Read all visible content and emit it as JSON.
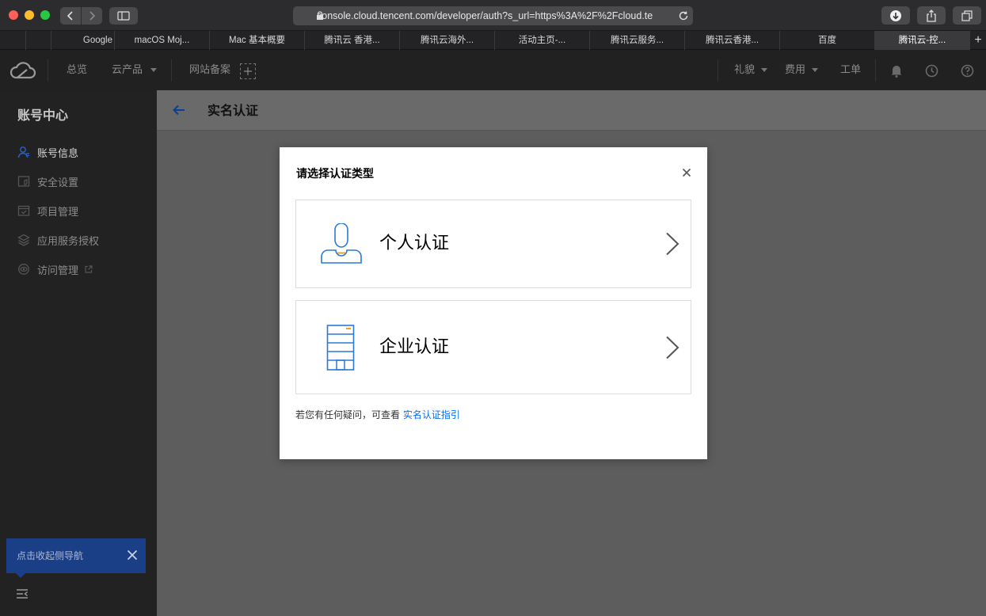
{
  "browser": {
    "url": "console.cloud.tencent.com/developer/auth?s_url=https%3A%2F%2Fcloud.te",
    "tabs": [
      {
        "label": "Google"
      },
      {
        "label": "macOS Moj..."
      },
      {
        "label": "Mac 基本概要"
      },
      {
        "label": "腾讯云 香港..."
      },
      {
        "label": "腾讯云海外..."
      },
      {
        "label": "活动主页-..."
      },
      {
        "label": "腾讯云服务..."
      },
      {
        "label": "腾讯云香港..."
      },
      {
        "label": "百度"
      },
      {
        "label": "腾讯云-控..."
      }
    ],
    "new_tab": "+"
  },
  "topnav": {
    "overview": "总览",
    "products": "云产品",
    "beian": "网站备案",
    "gifts": "礼貌",
    "billing": "费用",
    "tickets": "工单"
  },
  "sidebar": {
    "title": "账号中心",
    "items": [
      {
        "label": "账号信息",
        "icon": "user-icon",
        "active": true
      },
      {
        "label": "安全设置",
        "icon": "shield-icon",
        "active": false
      },
      {
        "label": "项目管理",
        "icon": "project-icon",
        "active": false
      },
      {
        "label": "应用服务授权",
        "icon": "layers-icon",
        "active": false
      },
      {
        "label": "访问管理",
        "icon": "access-icon",
        "active": false
      }
    ],
    "toast": "点击收起侧导航"
  },
  "page": {
    "title": "实名认证"
  },
  "modal": {
    "title": "请选择认证类型",
    "options": [
      {
        "label": "个人认证",
        "icon": "person-icon"
      },
      {
        "label": "企业认证",
        "icon": "building-icon"
      }
    ],
    "helper_text": "若您有任何疑问，可查看",
    "helper_link": "实名认证指引"
  },
  "colors": {
    "accent": "#006eff",
    "toast_bg": "#1b3f87"
  }
}
